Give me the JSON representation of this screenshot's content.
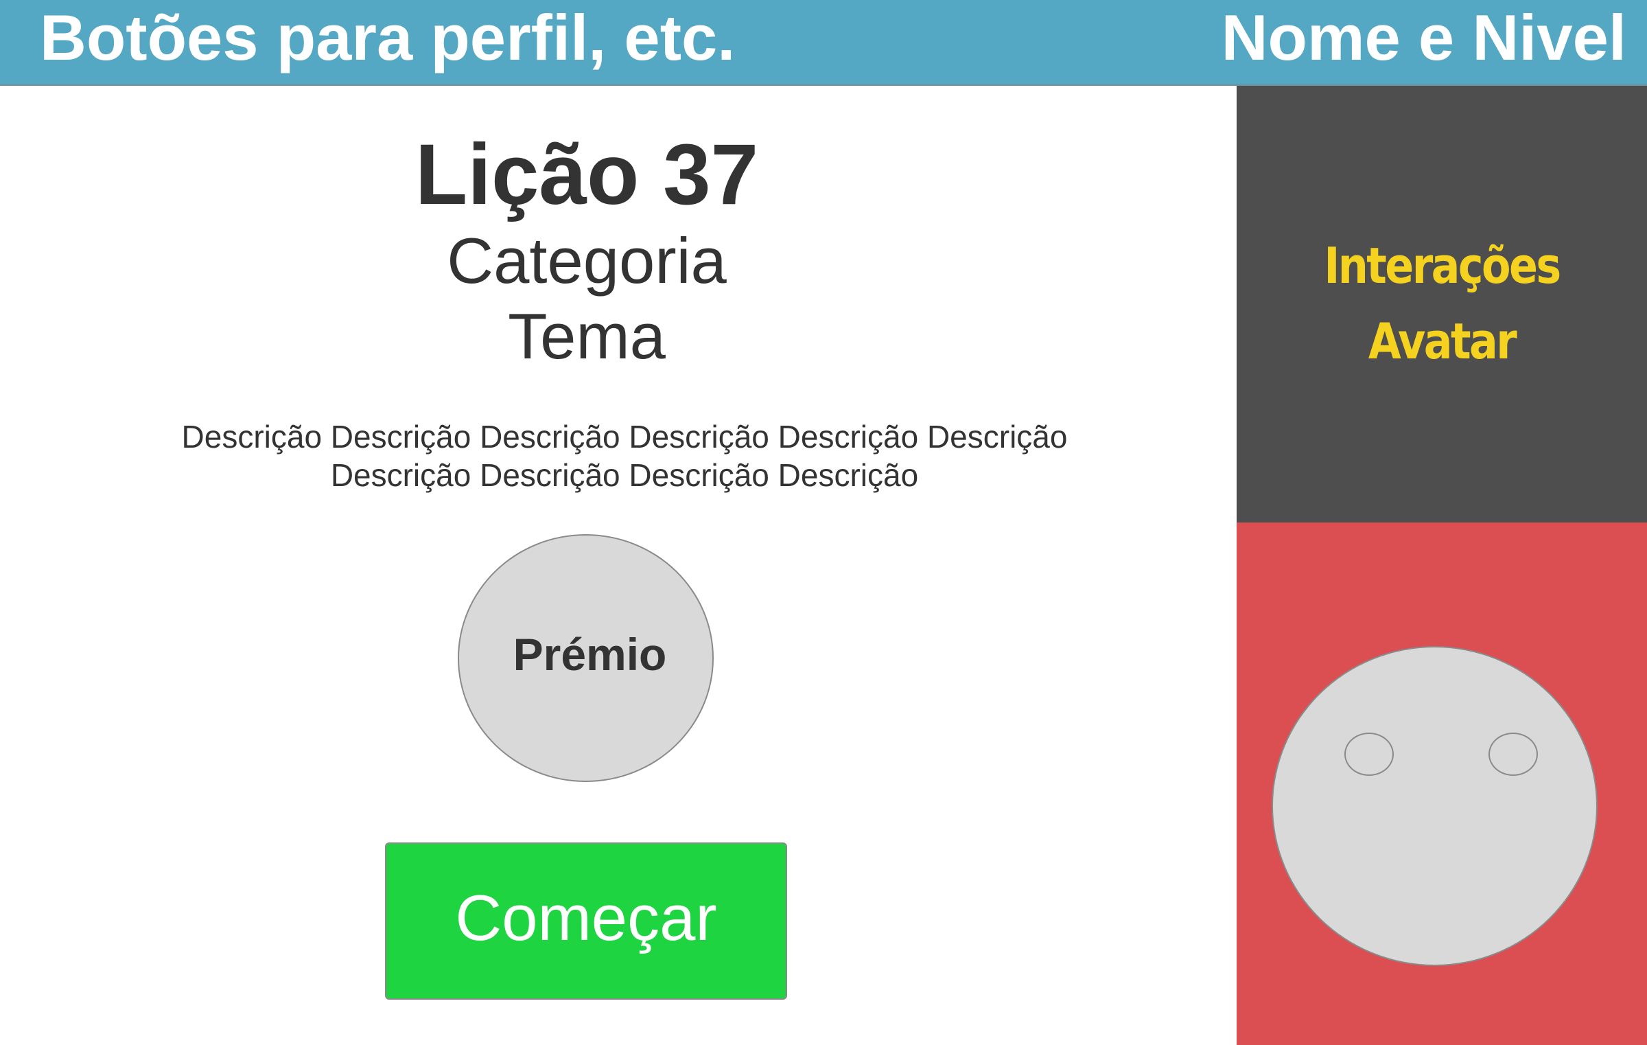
{
  "header": {
    "left_text": "Botões para perfil, etc.",
    "right_text": "Nome e Nivel"
  },
  "lesson": {
    "title": "Lição 37",
    "category": "Categoria",
    "theme": "Tema",
    "description": "Descrição Descrição Descrição Descrição Descrição Descrição Descrição Descrição Descrição Descrição",
    "prize_label": "Prémio",
    "start_label": "Começar"
  },
  "avatar_panel": {
    "line1": "Interações",
    "line2": "Avatar"
  },
  "colors": {
    "header_bg": "#55a8c4",
    "panel_bg": "#4e4e4e",
    "panel_text": "#f5d21f",
    "avatar_bg": "#db4f52",
    "start_button": "#1ed441",
    "placeholder_gray": "#d9d9d9"
  }
}
